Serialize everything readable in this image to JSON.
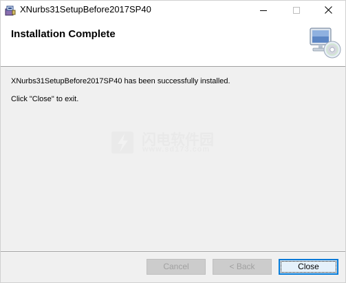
{
  "window": {
    "title": "XNurbs31SetupBefore2017SP40",
    "app_icon": "installer-box-icon",
    "controls": {
      "minimize": "minimize-icon",
      "maximize": "maximize-icon",
      "close": "close-icon"
    }
  },
  "banner": {
    "heading": "Installation Complete",
    "icon": "computer-cd-icon"
  },
  "body": {
    "message": "XNurbs31SetupBefore2017SP40 has been successfully installed.",
    "instruction": "Click \"Close\" to exit."
  },
  "watermark": {
    "text": "闪电软件园",
    "url": "www.sd173.com"
  },
  "buttons": {
    "cancel": "Cancel",
    "back": "< Back",
    "close": "Close"
  },
  "colors": {
    "accent": "#0078d7",
    "face": "#f0f0f0"
  }
}
